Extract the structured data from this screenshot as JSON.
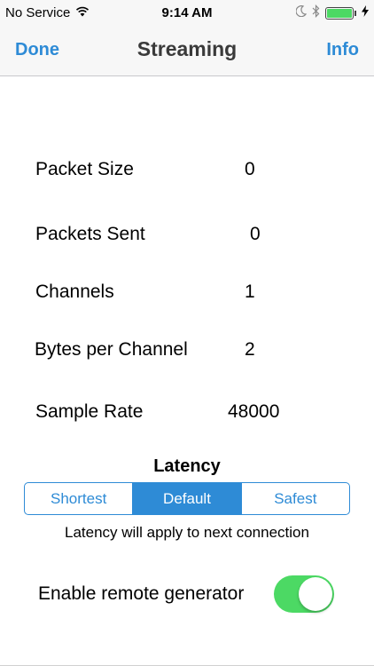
{
  "status_bar": {
    "carrier": "No Service",
    "time": "9:14 AM",
    "wifi_icon": "wifi-icon",
    "moon_icon": "moon-icon",
    "bluetooth_icon": "bluetooth-icon",
    "battery_level": 1.0,
    "battery_color": "#4cd964"
  },
  "nav": {
    "done_label": "Done",
    "title": "Streaming",
    "info_label": "Info"
  },
  "stats": {
    "packet_size": {
      "label": "Packet Size",
      "value": "0"
    },
    "packets_sent": {
      "label": "Packets Sent",
      "value": "0"
    },
    "channels": {
      "label": "Channels",
      "value": "1"
    },
    "bytes_per_channel": {
      "label": "Bytes per Channel",
      "value": "2"
    },
    "sample_rate": {
      "label": "Sample Rate",
      "value": "48000"
    }
  },
  "latency": {
    "title": "Latency",
    "options": [
      "Shortest",
      "Default",
      "Safest"
    ],
    "selected": "Default",
    "note": "Latency will apply to next connection"
  },
  "remote_generator": {
    "label": "Enable remote generator",
    "enabled": true
  },
  "colors": {
    "accent": "#2e8bd6",
    "toggle_on": "#4cd964"
  }
}
